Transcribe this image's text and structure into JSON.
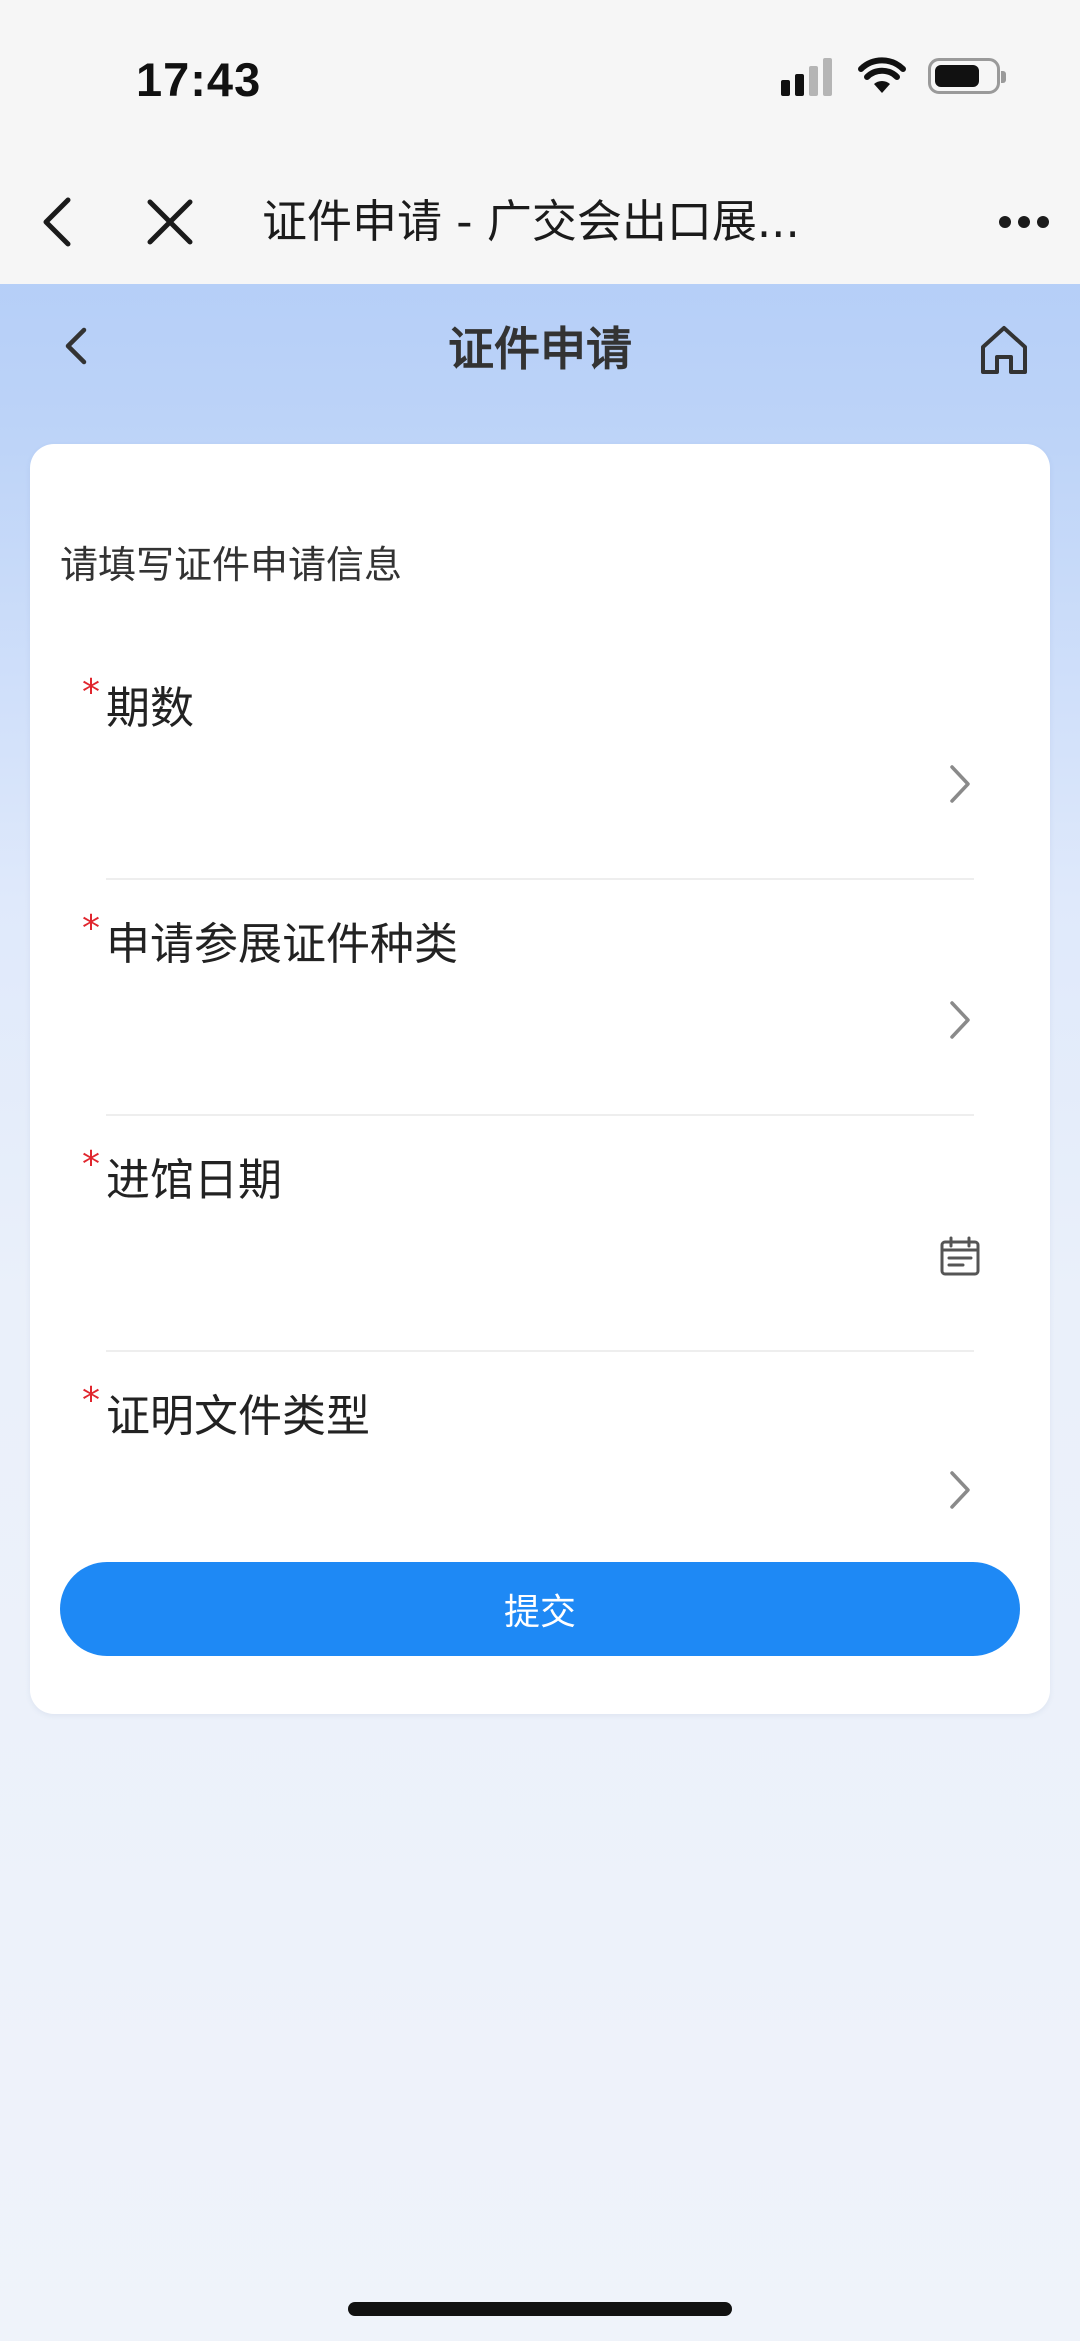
{
  "status_bar": {
    "time": "17:43",
    "signal_icon": "signal-icon",
    "wifi_icon": "wifi-icon",
    "battery_icon": "battery-icon",
    "battery_level": 0.7
  },
  "browser": {
    "title": "证件申请 - 广交会出口展...",
    "back_icon": "chevron-left-icon",
    "close_icon": "close-icon",
    "more_icon": "more-dots-icon"
  },
  "header": {
    "title": "证件申请",
    "back_icon": "chevron-left-icon",
    "home_icon": "home-icon"
  },
  "form": {
    "title": "请填写证件申请信息",
    "required_mark": "*",
    "fields": [
      {
        "label": "期数",
        "value": "",
        "icon": "chevron-right-icon"
      },
      {
        "label": "申请参展证件种类",
        "value": "",
        "icon": "chevron-right-icon"
      },
      {
        "label": "进馆日期",
        "value": "",
        "icon": "calendar-icon"
      },
      {
        "label": "证明文件类型",
        "value": "",
        "icon": "chevron-right-icon"
      }
    ],
    "submit_label": "提交"
  },
  "colors": {
    "accent": "#1e89f5",
    "required": "#e0262e",
    "header_bg": "#a9c6f6"
  }
}
